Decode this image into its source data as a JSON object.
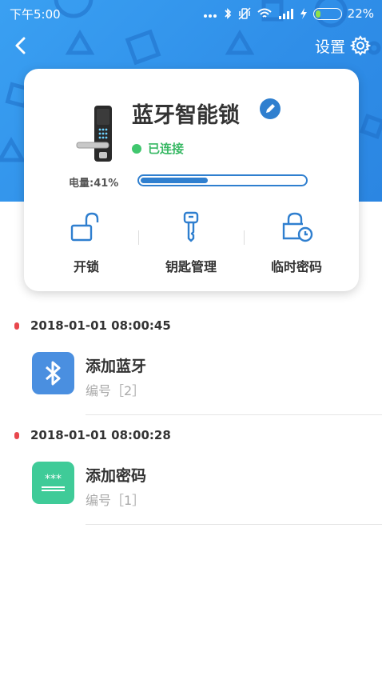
{
  "status_bar": {
    "time": "下午5:00",
    "battery_percent": "22%",
    "battery_level": 0.22
  },
  "header": {
    "settings_label": "设置"
  },
  "device": {
    "name": "蓝牙智能锁",
    "connection_status": "已连接",
    "power_label": "电量:41%",
    "power_level": 0.41
  },
  "actions": [
    {
      "label": "开锁",
      "icon": "unlock-icon"
    },
    {
      "label": "钥匙管理",
      "icon": "key-icon"
    },
    {
      "label": "临时密码",
      "icon": "lock-clock-icon"
    }
  ],
  "records": [
    {
      "time": "2018-01-01 08:00:45",
      "title": "添加蓝牙",
      "sub": "编号［2］",
      "icon": "bluetooth-icon",
      "color": "#4a8fe0"
    },
    {
      "time": "2018-01-01 08:00:28",
      "title": "添加密码",
      "sub": "编号［1］",
      "icon": "password-icon",
      "color": "#3fcb98"
    }
  ],
  "colors": {
    "hero_blue": "#3aa0f2",
    "accent_blue": "#2f7fcf",
    "connected_green": "#40c76e",
    "record_dot": "#e8474d"
  }
}
